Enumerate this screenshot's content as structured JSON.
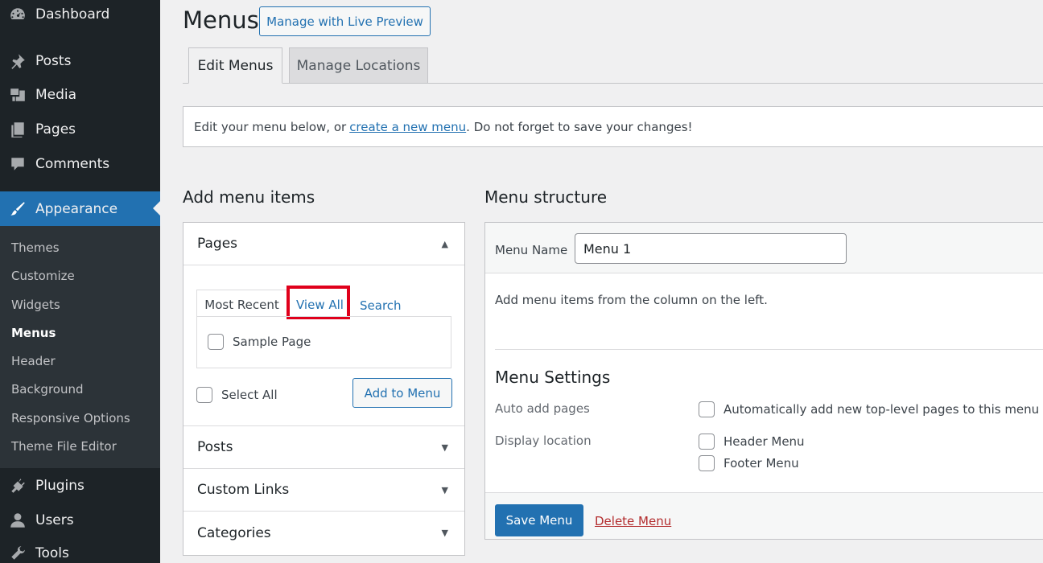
{
  "sidebar": {
    "top_items": [
      {
        "label": "Dashboard",
        "icon": "dashboard-icon"
      },
      {
        "label": "Posts",
        "icon": "pin-icon"
      },
      {
        "label": "Media",
        "icon": "media-icon"
      },
      {
        "label": "Pages",
        "icon": "pages-icon"
      },
      {
        "label": "Comments",
        "icon": "comment-icon"
      }
    ],
    "active_item": {
      "label": "Appearance",
      "icon": "paintbrush-icon"
    },
    "submenu": [
      "Themes",
      "Customize",
      "Widgets",
      "Menus",
      "Header",
      "Background",
      "Responsive Options",
      "Theme File Editor"
    ],
    "current_submenu": "Menus",
    "bottom_items": [
      {
        "label": "Plugins",
        "icon": "plugin-icon"
      },
      {
        "label": "Users",
        "icon": "user-icon"
      },
      {
        "label": "Tools",
        "icon": "wrench-icon"
      }
    ],
    "colors": {
      "background": "#1d2327",
      "submenu_background": "#2c3338",
      "active": "#2271b1"
    }
  },
  "header": {
    "title": "Menus",
    "live_preview_button": "Manage with Live Preview"
  },
  "tabs": [
    {
      "label": "Edit Menus",
      "active": true
    },
    {
      "label": "Manage Locations",
      "active": false
    }
  ],
  "notice": {
    "text_before": "Edit your menu below, or",
    "link": "create a new menu",
    "text_after": ". Do not forget to save your changes!"
  },
  "add_items": {
    "heading": "Add menu items",
    "sections": [
      {
        "title": "Pages",
        "expanded": true
      },
      {
        "title": "Posts",
        "expanded": false
      },
      {
        "title": "Custom Links",
        "expanded": false
      },
      {
        "title": "Categories",
        "expanded": false
      }
    ],
    "pages_subtabs": [
      "Most Recent",
      "View All",
      "Search"
    ],
    "page_items": [
      "Sample Page"
    ],
    "select_all": "Select All",
    "add_button": "Add to Menu"
  },
  "structure": {
    "heading": "Menu structure",
    "menu_name_label": "Menu Name",
    "menu_name_value": "Menu 1",
    "instructions": "Add menu items from the column on the left.",
    "settings_title": "Menu Settings",
    "auto_add_label": "Auto add pages",
    "auto_add_option": "Automatically add new top-level pages to this menu",
    "display_location_label": "Display location",
    "locations": [
      "Header Menu",
      "Footer Menu"
    ],
    "save_button": "Save Menu",
    "delete_link": "Delete Menu"
  },
  "accent_color": "#2271b1",
  "highlight_color": "#e0001b"
}
